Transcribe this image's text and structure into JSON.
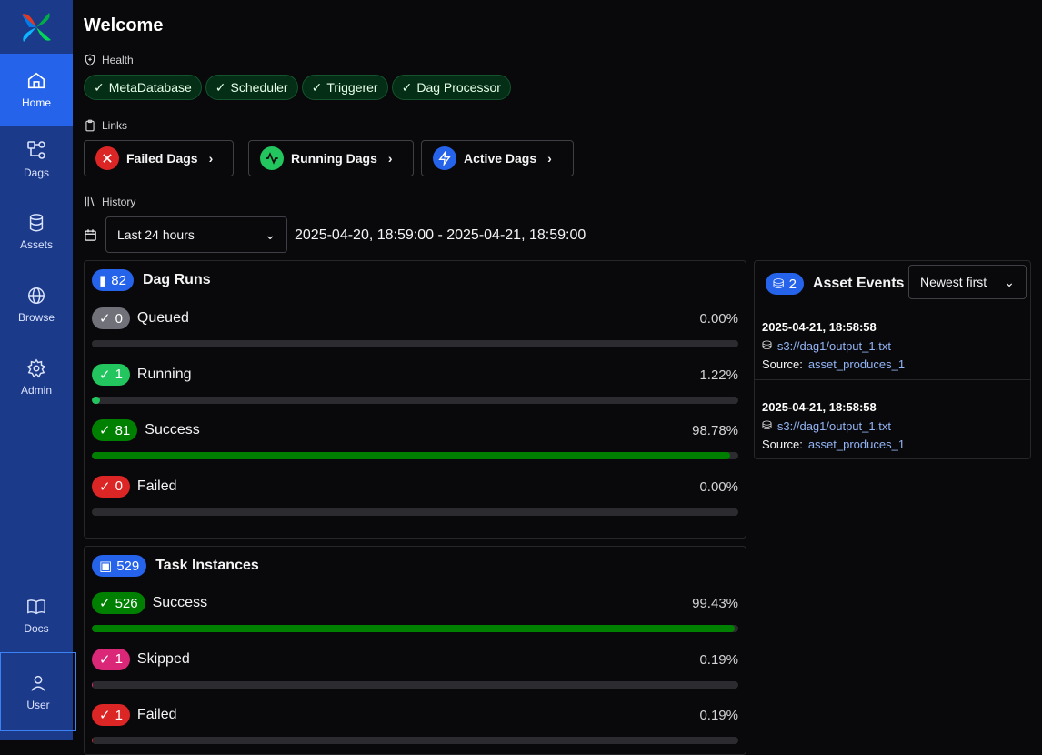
{
  "sidebar": {
    "items": [
      {
        "label": "Home",
        "icon": "home-icon"
      },
      {
        "label": "Dags",
        "icon": "dags-icon"
      },
      {
        "label": "Assets",
        "icon": "database-icon"
      },
      {
        "label": "Browse",
        "icon": "globe-icon"
      },
      {
        "label": "Admin",
        "icon": "gear-icon"
      },
      {
        "label": "Docs",
        "icon": "book-icon"
      },
      {
        "label": "User",
        "icon": "user-icon"
      }
    ]
  },
  "page": {
    "title": "Welcome",
    "health_label": "Health",
    "links_label": "Links",
    "history_label": "History"
  },
  "health": [
    "MetaDatabase",
    "Scheduler",
    "Triggerer",
    "Dag Processor"
  ],
  "links": {
    "failed": "Failed Dags",
    "running": "Running Dags",
    "active": "Active Dags"
  },
  "history": {
    "range_select": "Last 24 hours",
    "range_text": "2025-04-20, 18:59:00 - 2025-04-21, 18:59:00"
  },
  "dag_runs": {
    "title": "Dag Runs",
    "total": "82",
    "rows": [
      {
        "label": "Queued",
        "count": "0",
        "pct": "0.00%",
        "fraction": 0.0,
        "color": "#71717a"
      },
      {
        "label": "Running",
        "count": "1",
        "pct": "1.22%",
        "fraction": 0.0122,
        "color": "#22c55e"
      },
      {
        "label": "Success",
        "count": "81",
        "pct": "98.78%",
        "fraction": 0.9878,
        "color": "#008000"
      },
      {
        "label": "Failed",
        "count": "0",
        "pct": "0.00%",
        "fraction": 0.0,
        "color": "#dc2626"
      }
    ]
  },
  "task_instances": {
    "title": "Task Instances",
    "total": "529",
    "rows": [
      {
        "label": "Success",
        "count": "526",
        "pct": "99.43%",
        "fraction": 0.9943,
        "color": "#008000"
      },
      {
        "label": "Skipped",
        "count": "1",
        "pct": "0.19%",
        "fraction": 0.0019,
        "color": "#db2777"
      },
      {
        "label": "Failed",
        "count": "1",
        "pct": "0.19%",
        "fraction": 0.0019,
        "color": "#dc2626"
      }
    ]
  },
  "asset_events": {
    "title": "Asset Events",
    "count": "2",
    "sort": "Newest first",
    "events": [
      {
        "timestamp": "2025-04-21, 18:58:58",
        "uri": "s3://dag1/output_1.txt",
        "source_label": "Source:",
        "source": "asset_produces_1"
      },
      {
        "timestamp": "2025-04-21, 18:58:58",
        "uri": "s3://dag1/output_1.txt",
        "source_label": "Source:",
        "source": "asset_produces_1"
      }
    ]
  }
}
